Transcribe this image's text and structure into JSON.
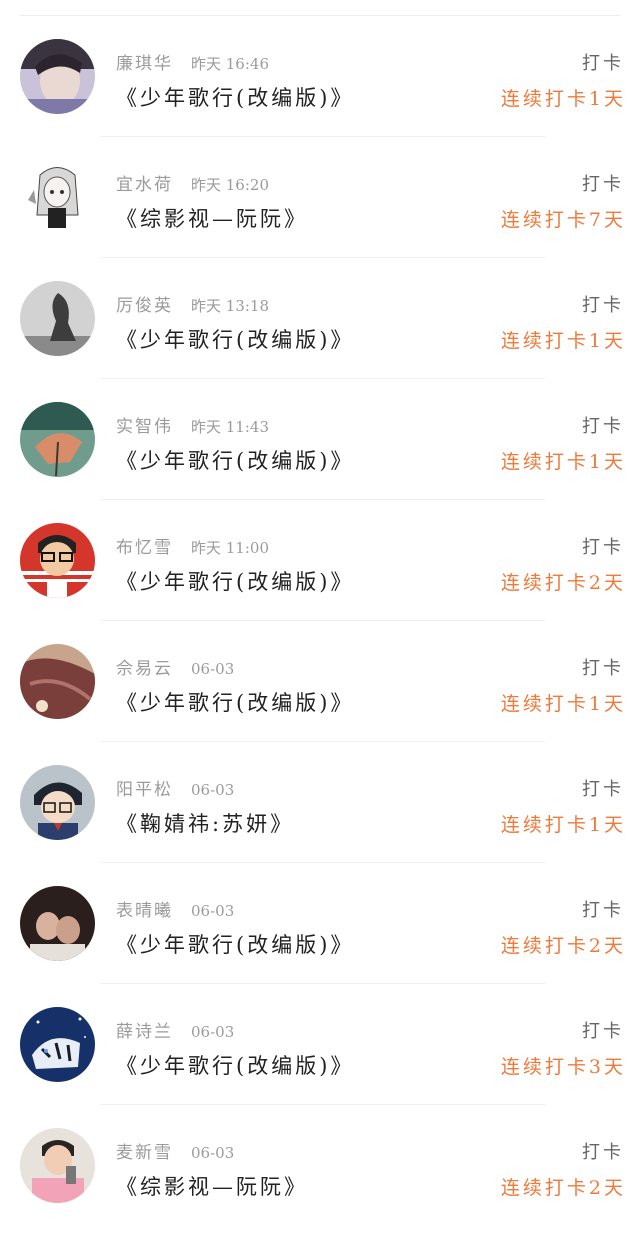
{
  "feed": {
    "items": [
      {
        "name": "廉琪华",
        "time": "昨天 16:46",
        "title": "《少年歌行(改编版)》",
        "action": "打卡",
        "streak": "连续打卡1天"
      },
      {
        "name": "宜水荷",
        "time": "昨天 16:20",
        "title": "《综影视—阮阮》",
        "action": "打卡",
        "streak": "连续打卡7天"
      },
      {
        "name": "厉俊英",
        "time": "昨天 13:18",
        "title": "《少年歌行(改编版)》",
        "action": "打卡",
        "streak": "连续打卡1天"
      },
      {
        "name": "实智伟",
        "time": "昨天 11:43",
        "title": "《少年歌行(改编版)》",
        "action": "打卡",
        "streak": "连续打卡1天"
      },
      {
        "name": "布忆雪",
        "time": "昨天 11:00",
        "title": "《少年歌行(改编版)》",
        "action": "打卡",
        "streak": "连续打卡2天"
      },
      {
        "name": "佘易云",
        "time": "06-03",
        "title": "《少年歌行(改编版)》",
        "action": "打卡",
        "streak": "连续打卡1天"
      },
      {
        "name": "阳平松",
        "time": "06-03",
        "title": "《鞠婧祎:苏妍》",
        "action": "打卡",
        "streak": "连续打卡1天"
      },
      {
        "name": "表晴曦",
        "time": "06-03",
        "title": "《少年歌行(改编版)》",
        "action": "打卡",
        "streak": "连续打卡2天"
      },
      {
        "name": "薛诗兰",
        "time": "06-03",
        "title": "《少年歌行(改编版)》",
        "action": "打卡",
        "streak": "连续打卡3天"
      },
      {
        "name": "麦新雪",
        "time": "06-03",
        "title": "《综影视—阮阮》",
        "action": "打卡",
        "streak": "连续打卡2天"
      }
    ]
  },
  "colors": {
    "streak": "#ef7a3a",
    "meta": "#9b9b9b",
    "divider": "#f0f0f0"
  }
}
